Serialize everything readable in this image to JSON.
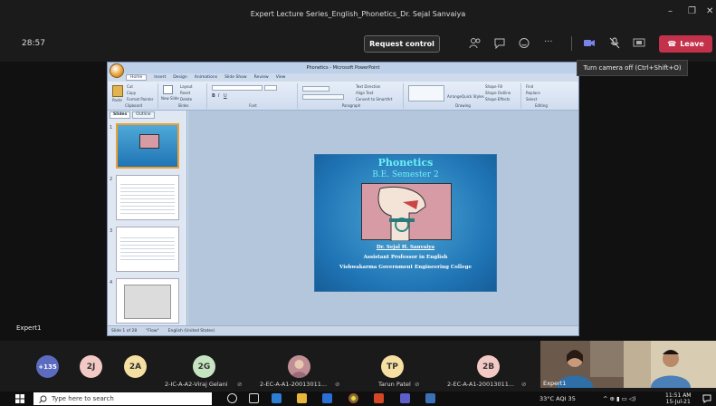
{
  "window": {
    "title": "Expert Lecture Series_English_Phonetics_Dr. Sejal Sanvaiya",
    "minimize": "–",
    "maximize": "❐",
    "close": "✕"
  },
  "meeting": {
    "elapsed": "28:57",
    "request_control": "Request control",
    "more": "···",
    "leave": "Leave",
    "tooltip": "Turn camera off (Ctrl+Shift+O)"
  },
  "ppt": {
    "title": "Phonetics - Microsoft PowerPoint",
    "tabs": [
      "Home",
      "Insert",
      "Design",
      "Animations",
      "Slide Show",
      "Review",
      "View"
    ],
    "groups": [
      "Clipboard",
      "Slides",
      "Font",
      "Paragraph",
      "Drawing",
      "Editing"
    ],
    "ribbon": {
      "paste": "Paste",
      "cut": "Cut",
      "copy": "Copy",
      "format_painter": "Format Painter",
      "new_slide": "New Slide",
      "layout": "Layout",
      "reset": "Reset",
      "delete": "Delete",
      "text_direction": "Text Direction",
      "align_text": "Align Text",
      "convert_smartart": "Convert to SmartArt",
      "arrange": "Arrange",
      "quick_styles": "Quick Styles",
      "shape_fill": "Shape Fill",
      "shape_outline": "Shape Outline",
      "shape_effects": "Shape Effects",
      "find": "Find",
      "replace": "Replace",
      "select": "Select"
    },
    "pane_tabs": [
      "Slides",
      "Outline"
    ],
    "thumbs": [
      "1",
      "2",
      "3",
      "4"
    ],
    "status": {
      "slide": "Slide 1 of 28",
      "theme": "\"Flow\"",
      "language": "English (United States)"
    }
  },
  "slide": {
    "title": "Phonetics",
    "subtitle": "B.E. Semester 2",
    "author": "Dr. Sejal H. Sanvaiya",
    "position": "Assistant Professor in English",
    "college": "Vishwakarma Government Engineering College"
  },
  "stage": {
    "presenter_label": "Expert1"
  },
  "participants": [
    {
      "initials": "+135",
      "name": "",
      "color": "#5b6bc0",
      "text_color": "#ffffff"
    },
    {
      "initials": "2J",
      "name": "",
      "color": "#f3c9c5",
      "text_color": "#333333"
    },
    {
      "initials": "2A",
      "name": "",
      "color": "#f5dfa2",
      "text_color": "#333333"
    },
    {
      "initials": "2G",
      "name": "2-IC-A-A2-Viraj Gelani",
      "color": "#c7e4c2",
      "text_color": "#333333"
    },
    {
      "initials": "",
      "name": "2-EC-A-A1-20013011...",
      "color": "#c08f96",
      "text_color": "#333333"
    },
    {
      "initials": "TP",
      "name": "Tarun Patel",
      "color": "#f5dfa2",
      "text_color": "#333333"
    },
    {
      "initials": "2B",
      "name": "2-EC-A-A1-20013011...",
      "color": "#f3c9c5",
      "text_color": "#333333"
    }
  ],
  "video_label": "Expert1",
  "taskbar": {
    "search_placeholder": "Type here to search",
    "weather": "33°C  AQI 35",
    "time": "11:51 AM",
    "date": "15-Jul-21"
  }
}
